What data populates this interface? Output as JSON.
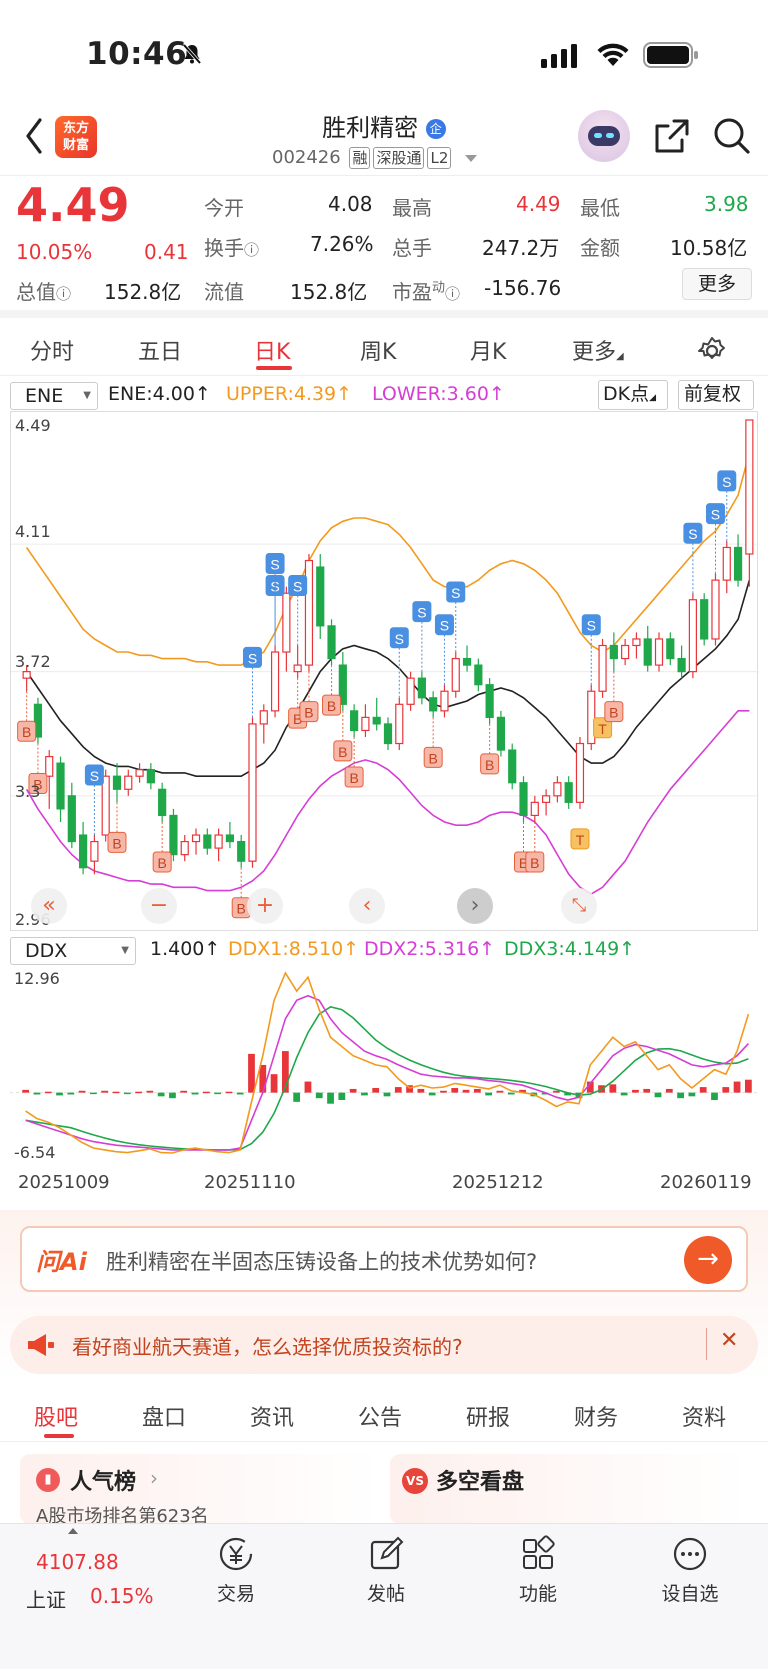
{
  "status": {
    "time": "10:46"
  },
  "header": {
    "app_logo": "东方\n财富",
    "stock_name": "胜利精密",
    "stock_code": "002426",
    "tags": [
      "融",
      "深股通",
      "L2"
    ]
  },
  "quote": {
    "price": "4.49",
    "change_pct": "10.05%",
    "change": "0.41",
    "open_label": "今开",
    "open": "4.08",
    "high_label": "最高",
    "high": "4.49",
    "low_label": "最低",
    "low": "3.98",
    "turnover_label": "换手",
    "turnover": "7.26%",
    "volume_label": "总手",
    "volume": "247.2万",
    "amount_label": "金额",
    "amount": "10.58亿",
    "mcap_label": "总值",
    "mcap": "152.8亿",
    "float_label": "流值",
    "float": "152.8亿",
    "pe_label": "市盈",
    "pe_sup": "动",
    "pe": "-156.76",
    "more_button": "更多"
  },
  "chart_tabs": [
    "分时",
    "五日",
    "日K",
    "周K",
    "月K",
    "更多"
  ],
  "chart_tab_active": "日K",
  "indicator": {
    "selector": "ENE",
    "ene": "ENE:4.00↑",
    "upper": "UPPER:4.39↑",
    "lower": "LOWER:3.60↑",
    "dk_button": "DK点",
    "adjust_button": "前复权"
  },
  "price_axis": [
    "4.49",
    "4.11",
    "3.72",
    "3.3",
    "2.96"
  ],
  "sub_indicator": {
    "selector": "DDX",
    "ddx": "1.400↑",
    "ddx1": "DDX1:8.510↑",
    "ddx2": "DDX2:5.316↑",
    "ddx3": "DDX3:4.149↑",
    "axis_top": "12.96",
    "axis_bottom": "-6.54"
  },
  "date_axis": [
    "20251009",
    "20251110",
    "20251212",
    "20260119"
  ],
  "ai_box": {
    "logo": "问Ai",
    "question": "胜利精密在半固态压铸设备上的技术优势如何?"
  },
  "promo": {
    "text": "看好商业航天赛道，怎么选择优质投资标的?"
  },
  "bottom_tabs": [
    "股吧",
    "盘口",
    "资讯",
    "公告",
    "研报",
    "财务",
    "资料"
  ],
  "cards": {
    "popular": "人气榜",
    "popular_sub": "A股市场排名第623名",
    "longshort": "多空看盘"
  },
  "footer": {
    "index_value": "4107.88",
    "index_name": "上证",
    "index_pct": "0.15%",
    "trade": "交易",
    "post": "发帖",
    "function": "功能",
    "watchlist": "设自选"
  },
  "colors": {
    "up": "#e8353a",
    "down": "#1fa84a",
    "upper": "#f39a1e",
    "lower": "#d63dd6",
    "ene": "#222222"
  },
  "chart_data": {
    "type": "candlestick",
    "ylim": [
      2.96,
      4.49
    ],
    "x_start_label": "20251009",
    "ohlc": [
      [
        3.7,
        3.74,
        3.66,
        3.72
      ],
      [
        3.62,
        3.64,
        3.5,
        3.52
      ],
      [
        3.4,
        3.48,
        3.3,
        3.46
      ],
      [
        3.44,
        3.46,
        3.26,
        3.3
      ],
      [
        3.34,
        3.38,
        3.18,
        3.2
      ],
      [
        3.22,
        3.26,
        3.1,
        3.12
      ],
      [
        3.14,
        3.22,
        3.1,
        3.2
      ],
      [
        3.22,
        3.42,
        3.2,
        3.4
      ],
      [
        3.4,
        3.44,
        3.32,
        3.36
      ],
      [
        3.36,
        3.42,
        3.34,
        3.4
      ],
      [
        3.4,
        3.44,
        3.38,
        3.42
      ],
      [
        3.42,
        3.44,
        3.36,
        3.38
      ],
      [
        3.36,
        3.38,
        3.26,
        3.28
      ],
      [
        3.28,
        3.3,
        3.14,
        3.16
      ],
      [
        3.16,
        3.22,
        3.14,
        3.2
      ],
      [
        3.2,
        3.24,
        3.16,
        3.22
      ],
      [
        3.22,
        3.24,
        3.16,
        3.18
      ],
      [
        3.18,
        3.24,
        3.14,
        3.22
      ],
      [
        3.22,
        3.26,
        3.18,
        3.2
      ],
      [
        3.2,
        3.22,
        3.12,
        3.14
      ],
      [
        3.14,
        3.58,
        3.12,
        3.56
      ],
      [
        3.56,
        3.62,
        3.5,
        3.6
      ],
      [
        3.6,
        3.8,
        3.58,
        3.78
      ],
      [
        3.78,
        3.98,
        3.72,
        3.96
      ],
      [
        3.72,
        3.8,
        3.7,
        3.74
      ],
      [
        3.74,
        4.08,
        3.72,
        4.06
      ],
      [
        4.04,
        4.08,
        3.82,
        3.86
      ],
      [
        3.86,
        3.88,
        3.74,
        3.76
      ],
      [
        3.74,
        3.78,
        3.6,
        3.62
      ],
      [
        3.6,
        3.62,
        3.52,
        3.54
      ],
      [
        3.54,
        3.62,
        3.52,
        3.58
      ],
      [
        3.58,
        3.64,
        3.54,
        3.56
      ],
      [
        3.56,
        3.58,
        3.48,
        3.5
      ],
      [
        3.5,
        3.64,
        3.48,
        3.62
      ],
      [
        3.62,
        3.72,
        3.6,
        3.7
      ],
      [
        3.7,
        3.72,
        3.62,
        3.64
      ],
      [
        3.64,
        3.66,
        3.58,
        3.6
      ],
      [
        3.6,
        3.68,
        3.58,
        3.66
      ],
      [
        3.66,
        3.78,
        3.64,
        3.76
      ],
      [
        3.76,
        3.8,
        3.72,
        3.74
      ],
      [
        3.74,
        3.76,
        3.66,
        3.68
      ],
      [
        3.68,
        3.7,
        3.56,
        3.58
      ],
      [
        3.58,
        3.6,
        3.46,
        3.48
      ],
      [
        3.48,
        3.5,
        3.36,
        3.38
      ],
      [
        3.38,
        3.4,
        3.26,
        3.28
      ],
      [
        3.28,
        3.34,
        3.26,
        3.32
      ],
      [
        3.32,
        3.36,
        3.28,
        3.34
      ],
      [
        3.34,
        3.4,
        3.32,
        3.38
      ],
      [
        3.38,
        3.4,
        3.3,
        3.32
      ],
      [
        3.32,
        3.52,
        3.3,
        3.5
      ],
      [
        3.5,
        3.68,
        3.48,
        3.66
      ],
      [
        3.66,
        3.82,
        3.64,
        3.8
      ],
      [
        3.8,
        3.84,
        3.72,
        3.76
      ],
      [
        3.76,
        3.82,
        3.74,
        3.8
      ],
      [
        3.8,
        3.84,
        3.76,
        3.82
      ],
      [
        3.82,
        3.86,
        3.72,
        3.74
      ],
      [
        3.74,
        3.84,
        3.72,
        3.82
      ],
      [
        3.82,
        3.84,
        3.74,
        3.76
      ],
      [
        3.76,
        3.8,
        3.7,
        3.72
      ],
      [
        3.72,
        3.96,
        3.7,
        3.94
      ],
      [
        3.94,
        3.96,
        3.8,
        3.82
      ],
      [
        3.82,
        4.02,
        3.8,
        4.0
      ],
      [
        4.0,
        4.12,
        3.96,
        4.1
      ],
      [
        4.1,
        4.14,
        3.98,
        4.0
      ],
      [
        4.08,
        4.49,
        3.98,
        4.49
      ]
    ],
    "upper": [
      4.1,
      4.05,
      4.0,
      3.95,
      3.9,
      3.85,
      3.82,
      3.8,
      3.78,
      3.78,
      3.77,
      3.77,
      3.76,
      3.76,
      3.76,
      3.75,
      3.75,
      3.74,
      3.74,
      3.74,
      3.76,
      3.78,
      3.84,
      3.92,
      3.98,
      4.06,
      4.12,
      4.16,
      4.18,
      4.19,
      4.19,
      4.18,
      4.17,
      4.14,
      4.1,
      4.05,
      4.0,
      3.98,
      3.98,
      3.98,
      4.0,
      4.03,
      4.05,
      4.06,
      4.05,
      4.03,
      4.0,
      3.96,
      3.9,
      3.84,
      3.8,
      3.78,
      3.8,
      3.84,
      3.88,
      3.92,
      3.96,
      4.0,
      4.04,
      4.08,
      4.12,
      4.15,
      4.2,
      4.26,
      4.39
    ],
    "ene": [
      3.72,
      3.67,
      3.62,
      3.57,
      3.53,
      3.49,
      3.46,
      3.44,
      3.43,
      3.43,
      3.42,
      3.42,
      3.41,
      3.41,
      3.41,
      3.4,
      3.4,
      3.4,
      3.4,
      3.4,
      3.42,
      3.44,
      3.48,
      3.55,
      3.6,
      3.66,
      3.72,
      3.76,
      3.79,
      3.8,
      3.79,
      3.78,
      3.76,
      3.73,
      3.69,
      3.65,
      3.62,
      3.61,
      3.62,
      3.63,
      3.65,
      3.66,
      3.67,
      3.66,
      3.64,
      3.61,
      3.58,
      3.54,
      3.5,
      3.46,
      3.44,
      3.44,
      3.46,
      3.5,
      3.55,
      3.59,
      3.63,
      3.67,
      3.7,
      3.73,
      3.76,
      3.79,
      3.83,
      3.88,
      4.0
    ],
    "lower": [
      3.36,
      3.3,
      3.25,
      3.2,
      3.16,
      3.13,
      3.11,
      3.1,
      3.09,
      3.08,
      3.08,
      3.07,
      3.07,
      3.06,
      3.06,
      3.06,
      3.05,
      3.05,
      3.05,
      3.06,
      3.08,
      3.11,
      3.16,
      3.22,
      3.28,
      3.33,
      3.37,
      3.4,
      3.42,
      3.44,
      3.45,
      3.44,
      3.42,
      3.39,
      3.35,
      3.31,
      3.28,
      3.26,
      3.25,
      3.25,
      3.26,
      3.28,
      3.29,
      3.29,
      3.28,
      3.26,
      3.22,
      3.16,
      3.1,
      3.06,
      3.04,
      3.06,
      3.1,
      3.14,
      3.2,
      3.26,
      3.31,
      3.36,
      3.4,
      3.44,
      3.48,
      3.52,
      3.56,
      3.6,
      3.6
    ],
    "signals": [
      {
        "i": 0,
        "t": "B"
      },
      {
        "i": 1,
        "t": "B"
      },
      {
        "i": 6,
        "t": "S"
      },
      {
        "i": 8,
        "t": "B"
      },
      {
        "i": 12,
        "t": "B"
      },
      {
        "i": 19,
        "t": "B"
      },
      {
        "i": 20,
        "t": "S"
      },
      {
        "i": 22,
        "t": "S"
      },
      {
        "i": 22,
        "t": "S"
      },
      {
        "i": 24,
        "t": "S"
      },
      {
        "i": 24,
        "t": "B"
      },
      {
        "i": 25,
        "t": "B"
      },
      {
        "i": 27,
        "t": "B"
      },
      {
        "i": 28,
        "t": "B"
      },
      {
        "i": 29,
        "t": "B"
      },
      {
        "i": 33,
        "t": "S"
      },
      {
        "i": 35,
        "t": "S"
      },
      {
        "i": 36,
        "t": "B"
      },
      {
        "i": 37,
        "t": "S"
      },
      {
        "i": 38,
        "t": "S"
      },
      {
        "i": 41,
        "t": "B"
      },
      {
        "i": 44,
        "t": "B"
      },
      {
        "i": 45,
        "t": "B"
      },
      {
        "i": 49,
        "t": "T"
      },
      {
        "i": 50,
        "t": "S"
      },
      {
        "i": 51,
        "t": "T"
      },
      {
        "i": 52,
        "t": "B"
      },
      {
        "i": 59,
        "t": "S"
      },
      {
        "i": 61,
        "t": "S"
      },
      {
        "i": 62,
        "t": "S"
      }
    ],
    "ddx": {
      "ylim": [
        -6.54,
        12.96
      ],
      "bars": [
        0.3,
        -0.2,
        0.1,
        -0.3,
        -0.2,
        0.2,
        -0.1,
        0.2,
        0.1,
        -0.1,
        0.1,
        0.2,
        -0.4,
        -0.6,
        0.2,
        -0.2,
        0.1,
        -0.1,
        0.1,
        -0.2,
        4.2,
        3.0,
        2.0,
        4.5,
        -1.0,
        1.2,
        -0.6,
        -1.2,
        -0.8,
        0.4,
        -0.3,
        0.5,
        -0.4,
        0.6,
        0.8,
        0.4,
        -0.3,
        0.2,
        0.5,
        0.3,
        0.4,
        -0.3,
        0.2,
        -0.2,
        0.3,
        -0.4,
        -0.2,
        0.2,
        -0.3,
        -0.6,
        1.2,
        0.8,
        0.9,
        -0.3,
        0.3,
        0.4,
        -0.5,
        0.4,
        -0.6,
        -0.4,
        0.6,
        -0.8,
        0.6,
        1.2,
        1.4
      ],
      "ddx1": [
        -2.0,
        -2.8,
        -3.2,
        -3.8,
        -4.6,
        -5.4,
        -6.0,
        -6.2,
        -6.4,
        -6.5,
        -6.3,
        -6.1,
        -6.5,
        -6.54,
        -6.2,
        -6.0,
        -6.2,
        -6.4,
        -6.5,
        -6.2,
        -1.0,
        4.0,
        10.0,
        12.96,
        11.0,
        12.5,
        9.0,
        6.0,
        5.0,
        4.0,
        3.5,
        3.0,
        2.8,
        1.5,
        0.5,
        0.8,
        0.5,
        0.6,
        1.0,
        0.8,
        0.6,
        0.4,
        0.8,
        0.2,
        0.0,
        -0.2,
        -0.8,
        -1.5,
        -1.0,
        -1.2,
        3.0,
        4.5,
        6.0,
        5.0,
        5.5,
        4.0,
        2.5,
        3.0,
        1.5,
        0.5,
        1.5,
        2.5,
        2.0,
        4.5,
        8.51
      ],
      "ddx2": [
        -3.0,
        -3.4,
        -3.8,
        -4.2,
        -4.6,
        -5.0,
        -5.3,
        -5.5,
        -5.7,
        -5.8,
        -5.9,
        -6.0,
        -6.1,
        -6.2,
        -6.2,
        -6.2,
        -6.2,
        -6.2,
        -6.2,
        -6.0,
        -3.0,
        0.0,
        4.0,
        8.0,
        10.0,
        10.5,
        10.0,
        8.0,
        6.5,
        5.5,
        4.5,
        4.0,
        3.6,
        3.0,
        2.5,
        2.0,
        1.8,
        1.7,
        1.6,
        1.6,
        1.5,
        1.3,
        1.2,
        1.0,
        0.8,
        0.4,
        0.0,
        -0.5,
        -0.8,
        -0.5,
        1.0,
        2.5,
        4.0,
        4.8,
        5.2,
        5.0,
        4.6,
        4.2,
        3.6,
        3.0,
        2.8,
        3.0,
        3.2,
        4.0,
        5.316
      ]
    }
  }
}
